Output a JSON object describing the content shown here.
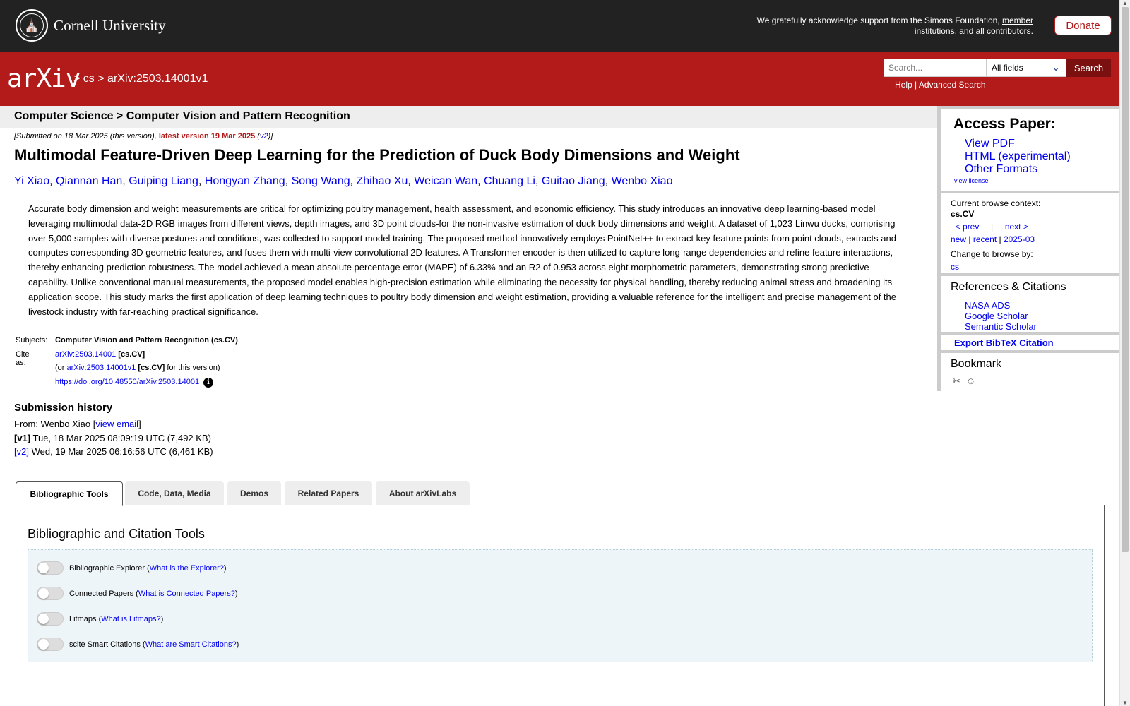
{
  "top": {
    "university": "Cornell University",
    "ack_text": "We gratefully acknowledge support from the Simons Foundation,",
    "ack_link": "member institutions",
    "ack_tail": ", and all contributors.",
    "donate": "Donate"
  },
  "header": {
    "logo": "arXiv",
    "breadcrumb_sep1": ">",
    "breadcrumb_cs": "cs",
    "breadcrumb_sep2": ">",
    "breadcrumb_id": "arXiv:2503.14001v1",
    "search_placeholder": "Search...",
    "search_field": "All fields",
    "search_button": "Search",
    "help": "Help",
    "help_sep": "|",
    "advanced": "Advanced Search"
  },
  "subject_bar": "Computer Science > Computer Vision and Pattern Recognition",
  "submitted": {
    "prefix": "[Submitted on 18 Mar 2025 (this version), ",
    "latest": "latest version 19 Mar 2025",
    "v2_open": " (",
    "v2": "v2",
    "v2_close": ")]"
  },
  "title": "Multimodal Feature-Driven Deep Learning for the Prediction of Duck Body Dimensions and Weight",
  "authors": [
    "Yi Xiao",
    "Qiannan Han",
    "Guiping Liang",
    "Hongyan Zhang",
    "Song Wang",
    "Zhihao Xu",
    "Weican Wan",
    "Chuang Li",
    "Guitao Jiang",
    "Wenbo Xiao"
  ],
  "abstract": "Accurate body dimension and weight measurements are critical for optimizing poultry management, health assessment, and economic efficiency. This study introduces an innovative deep learning-based model leveraging multimodal data-2D RGB images from different views, depth images, and 3D point clouds-for the non-invasive estimation of duck body dimensions and weight. A dataset of 1,023 Linwu ducks, comprising over 5,000 samples with diverse postures and conditions, was collected to support model training. The proposed method innovatively employs PointNet++ to extract key feature points from point clouds, extracts and computes corresponding 3D geometric features, and fuses them with multi-view convolutional 2D features. A Transformer encoder is then utilized to capture long-range dependencies and refine feature interactions, thereby enhancing prediction robustness. The model achieved a mean absolute percentage error (MAPE) of 6.33% and an R2 of 0.953 across eight morphometric parameters, demonstrating strong predictive capability. Unlike conventional manual measurements, the proposed model enables high-precision estimation while eliminating the necessity for physical handling, thereby reducing animal stress and broadening its application scope. This study marks the first application of deep learning techniques to poultry body dimension and weight estimation, providing a valuable reference for the intelligent and precise management of the livestock industry with far-reaching practical significance.",
  "meta": {
    "subjects_label": "Subjects:",
    "subjects": "Computer Vision and Pattern Recognition (cs.CV)",
    "cite_label": "Cite as:",
    "cite_id": "arXiv:2503.14001",
    "cite_cat": "[cs.CV]",
    "cite2_prefix": "(or ",
    "cite2_id": "arXiv:2503.14001v1",
    "cite2_cat": "[cs.CV]",
    "cite2_suffix": " for this version)",
    "doi": "https://doi.org/10.48550/arXiv.2503.14001",
    "info_icon": "i"
  },
  "history": {
    "title": "Submission history",
    "from_prefix": "From: Wenbo Xiao [",
    "view_email": "view email",
    "from_suffix": "]",
    "v1_label": "[v1]",
    "v1_text": " Tue, 18 Mar 2025 08:09:19 UTC (7,492 KB)",
    "v2_label": "[v2]",
    "v2_text": " Wed, 19 Mar 2025 06:16:56 UTC (6,461 KB)"
  },
  "sidebar": {
    "access_title": "Access Paper:",
    "view_pdf": "View PDF",
    "html": "HTML (experimental)",
    "other_formats": "Other Formats",
    "view_license": "view license",
    "context_label": "Current browse context:",
    "context": "cs.CV",
    "prev": "< prev",
    "nav_sep": "|",
    "next": "next >",
    "new": "new",
    "recent": "recent",
    "month": "2025-03",
    "sep": "|",
    "change_label": "Change to browse by:",
    "cs": "cs",
    "refs_title": "References & Citations",
    "nasa": "NASA ADS",
    "google": "Google Scholar",
    "semantic": "Semantic Scholar",
    "bibtex": "Export BibTeX Citation",
    "bookmark": "Bookmark",
    "bm_icon1": "✂",
    "bm_icon2": "☺"
  },
  "tabs": [
    "Bibliographic Tools",
    "Code, Data, Media",
    "Demos",
    "Related Papers",
    "About arXivLabs"
  ],
  "panel": {
    "title": "Bibliographic and Citation Tools",
    "tools": [
      {
        "name": "Bibliographic Explorer",
        "link": "What is the Explorer?"
      },
      {
        "name": "Connected Papers",
        "link": "What is Connected Papers?"
      },
      {
        "name": "Litmaps",
        "link": "What is Litmaps?"
      },
      {
        "name": "scite Smart Citations",
        "link": "What are Smart Citations?"
      }
    ]
  },
  "colors": {
    "header_red": "#b31b1b",
    "top_dark": "#222222",
    "link_blue": "#0000ee"
  },
  "icons": {
    "seal": "cornell-seal-icon",
    "chevron": "chevron-down-icon",
    "info": "info-icon"
  }
}
